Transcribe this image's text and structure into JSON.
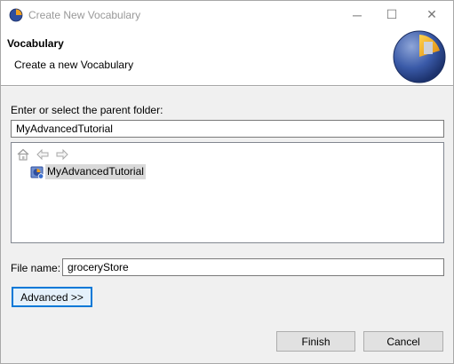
{
  "window": {
    "title": "Create New Vocabulary",
    "controls": {
      "minimize": "─",
      "maximize": "☐",
      "close": "✕"
    }
  },
  "header": {
    "title": "Vocabulary",
    "description": "Create a new Vocabulary",
    "logo_icon": "vocabulary-wizard-logo"
  },
  "form": {
    "parent_folder_label": "Enter or select the parent folder:",
    "parent_folder_value": "MyAdvancedTutorial",
    "tree": {
      "nav_icons": [
        "home-icon",
        "back-arrow-icon",
        "forward-arrow-icon"
      ],
      "items": [
        {
          "label": "MyAdvancedTutorial",
          "icon": "project-folder-icon",
          "selected": true
        }
      ]
    },
    "file_name_label": "File name:",
    "file_name_value": "groceryStore",
    "advanced_label": "Advanced >>"
  },
  "footer": {
    "finish_label": "Finish",
    "cancel_label": "Cancel"
  },
  "colors": {
    "focus_border": "#0078d7",
    "selection_bg": "#d9d9d9",
    "logo_blue": "#2f4f9f",
    "logo_orange": "#f0a020"
  }
}
